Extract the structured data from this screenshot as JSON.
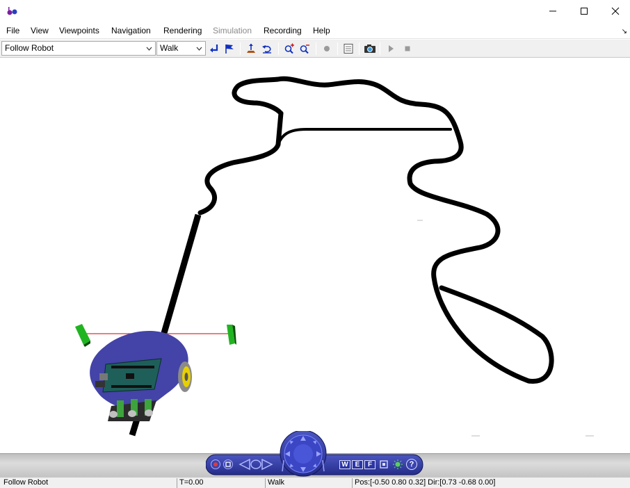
{
  "window": {
    "icon": "vrml-viewer-app-icon",
    "controls": [
      "minimize-icon",
      "maximize-icon",
      "close-icon"
    ]
  },
  "menu": {
    "items": [
      "File",
      "View",
      "Viewpoints",
      "Navigation",
      "Rendering",
      "Simulation",
      "Recording",
      "Help"
    ],
    "disabled": [
      "Simulation"
    ]
  },
  "toolbar": {
    "viewpoint_select": "Follow Robot",
    "nav_mode_select": "Walk",
    "buttons": [
      "return-viewpoint-icon",
      "set-viewpoint-flag-icon",
      "align-icon",
      "restore-icon",
      "zoom-in-icon",
      "zoom-out-icon",
      "record-icon",
      "text-view-icon",
      "screenshot-icon",
      "play-icon",
      "stop-icon"
    ]
  },
  "scene": {
    "track_color": "#000000",
    "robot_body_color": "#4343a8",
    "sensor_color": "#21b421",
    "sensor_beam_color": "#e03030",
    "board_color": "#1f5f5a"
  },
  "dashboard": {
    "buttons": [
      "close-dash-icon",
      "minimize-dash-icon",
      "prev-viewpoint-icon",
      "reset-view-icon",
      "next-viewpoint-icon",
      "navigation-pad-icon",
      "walk-w-icon",
      "examine-e-icon",
      "fly-f-icon",
      "fit-icon",
      "headlight-icon",
      "help-icon"
    ],
    "mode_letters": [
      "W",
      "E",
      "F"
    ],
    "help_glyph": "?"
  },
  "status": {
    "viewpoint": "Follow Robot",
    "time": "T=0.00",
    "mode": "Walk",
    "position": "Pos:[-0.50 0.80 0.32] Dir:[0.73 -0.68 0.00]"
  }
}
